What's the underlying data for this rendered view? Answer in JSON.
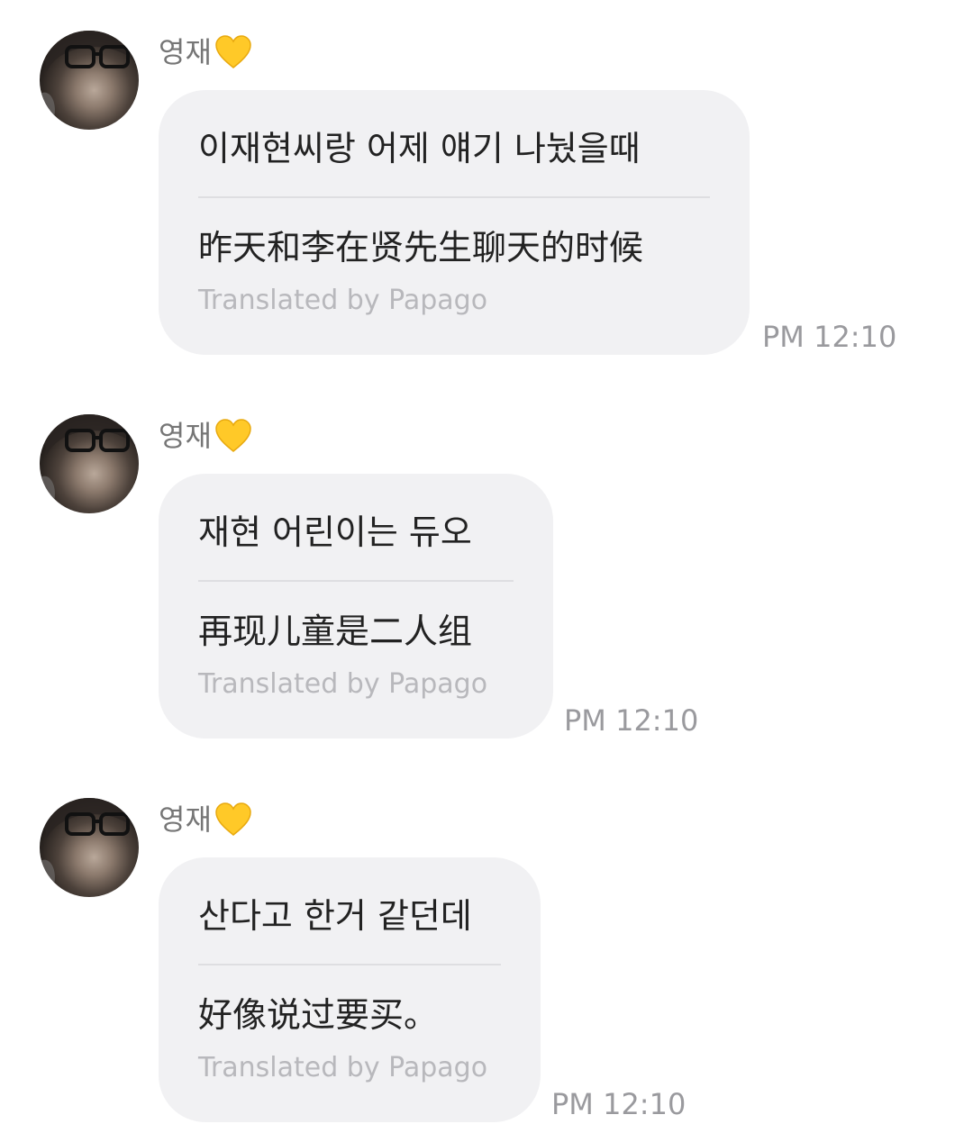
{
  "messages": [
    {
      "sender": "영재",
      "sender_icon": "yellow-heart-icon",
      "original": "이재현씨랑 어제 얘기 나눴을때",
      "translated": "昨天和李在贤先生聊天的时候",
      "credit": "Translated by Papago",
      "time": "PM 12:10"
    },
    {
      "sender": "영재",
      "sender_icon": "yellow-heart-icon",
      "original": "재현 어린이는 듀오",
      "translated": "再现儿童是二人组",
      "credit": "Translated by Papago",
      "time": "PM 12:10"
    },
    {
      "sender": "영재",
      "sender_icon": "yellow-heart-icon",
      "original": "산다고 한거 같던데",
      "translated": "好像说过要买。",
      "credit": "Translated by Papago",
      "time": "PM 12:10"
    }
  ],
  "colors": {
    "bubble": "#f1f1f3",
    "heart": "#ffc928",
    "text": "#222222",
    "credit": "#b8b8bc",
    "time": "#9a9a9e"
  }
}
